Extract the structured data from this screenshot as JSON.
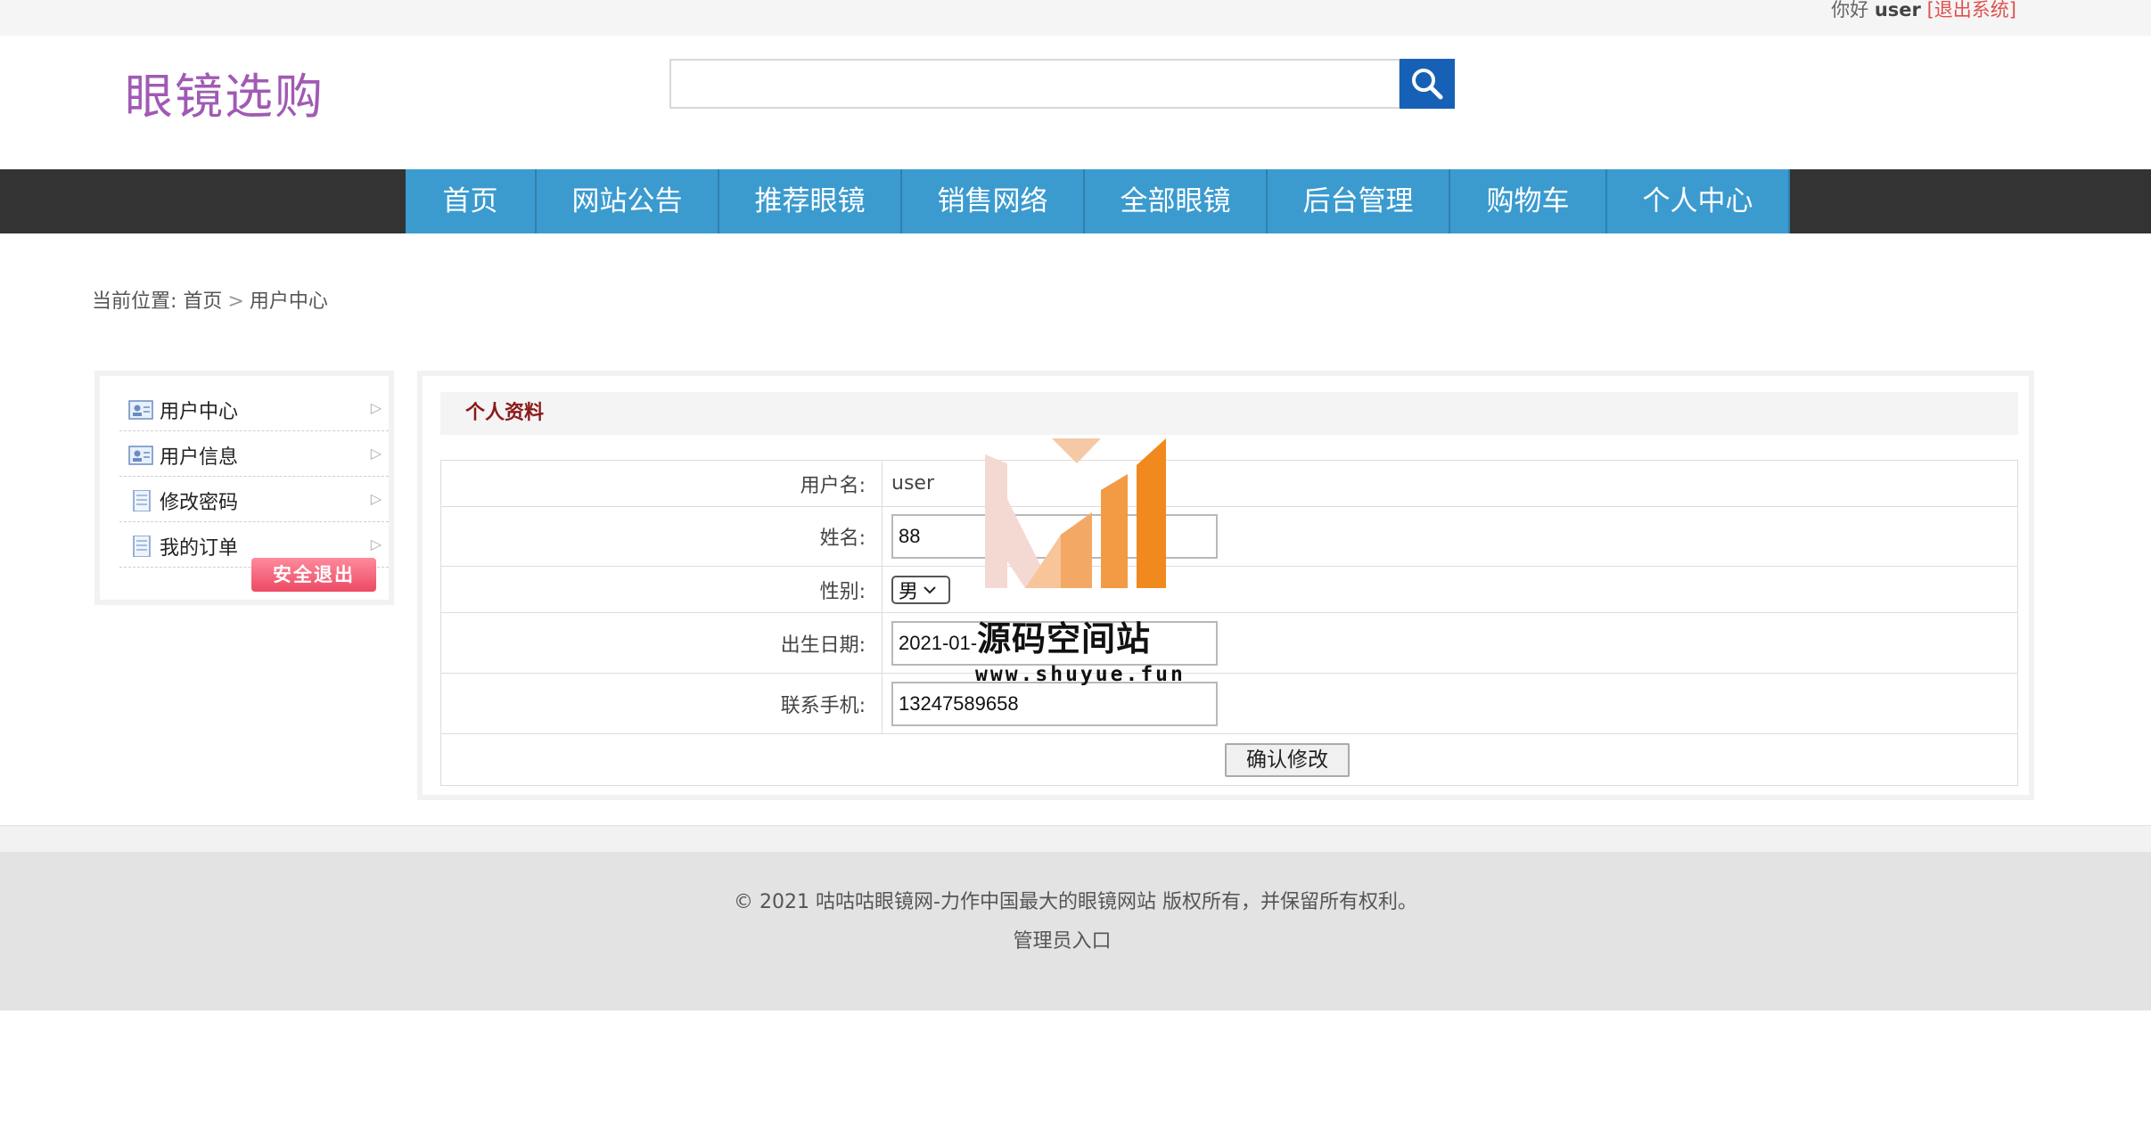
{
  "topbar": {
    "greeting": "你好",
    "username": "user",
    "logout_link": "[退出系统]"
  },
  "header": {
    "logo_text": "眼镜选购",
    "search_placeholder": ""
  },
  "nav": [
    "首页",
    "网站公告",
    "推荐眼镜",
    "销售网络",
    "全部眼镜",
    "后台管理",
    "购物车",
    "个人中心"
  ],
  "breadcrumb": {
    "prefix": "当前位置:",
    "home": "首页",
    "separator": ">",
    "current": "用户中心"
  },
  "sidebar": {
    "items": [
      {
        "label": "用户中心",
        "icon": "user-card-icon"
      },
      {
        "label": "用户信息",
        "icon": "user-card-icon"
      },
      {
        "label": "修改密码",
        "icon": "document-icon"
      },
      {
        "label": "我的订单",
        "icon": "document-icon"
      }
    ],
    "arrow": "▷",
    "logout_button": "安全退出"
  },
  "profile": {
    "title": "个人资料",
    "username_label": "用户名:",
    "username_value": "user",
    "name_label": "姓名:",
    "name_value": "88",
    "gender_label": "性别:",
    "gender_value": "男",
    "birth_label": "出生日期:",
    "birth_value": "2021-01-",
    "phone_label": "联系手机:",
    "phone_value": "13247589658",
    "submit_label": "确认修改"
  },
  "watermark": {
    "title": "源码空间站",
    "url": "www.shuyue.fun"
  },
  "footer": {
    "copyright": "© 2021 咕咕咕眼镜网-力作中国最大的眼镜网站 版权所有，并保留所有权利。",
    "admin_link": "管理员入口"
  },
  "colors": {
    "nav_bg": "#3b9bcf",
    "nav_bar": "#333333",
    "logo": "#a05ab4",
    "search_button": "#1661b6",
    "logout": "#ec4a64",
    "panel_title": "#8b1a1a"
  }
}
